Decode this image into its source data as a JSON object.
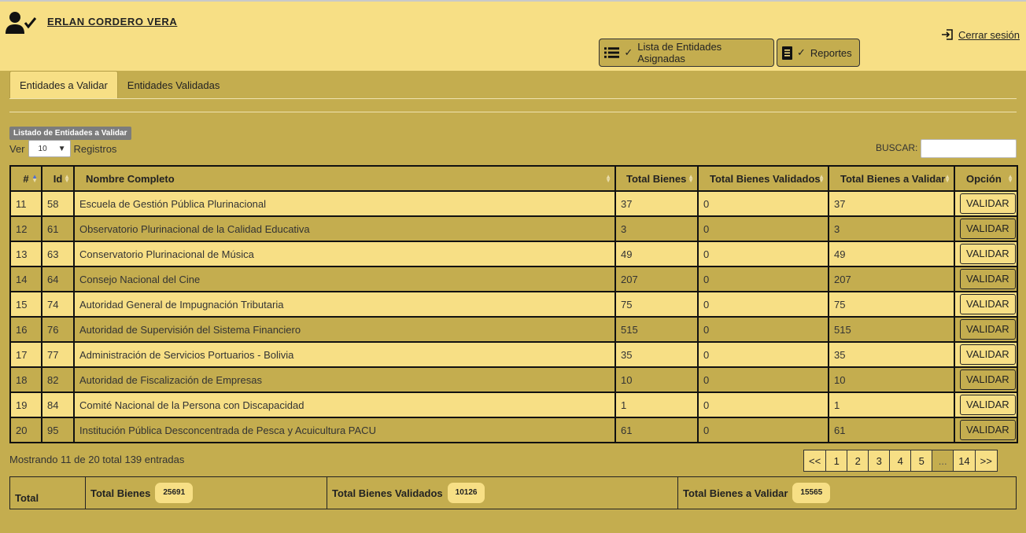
{
  "header": {
    "user_name": "ERLAN CORDERO VERA",
    "logout_label": "Cerrar sesión",
    "btn_list_label": "Lista de Entidades Asignadas",
    "btn_reports_label": "Reportes",
    "check_mark": "✓"
  },
  "tabs": [
    {
      "label": "Entidades a Validar",
      "active": true
    },
    {
      "label": "Entidades Validadas",
      "active": false
    }
  ],
  "listing": {
    "badge": "Listado de Entidades a Validar",
    "ver_label": "Ver",
    "page_size": "10",
    "registros_label": "Registros",
    "search_label": "BUSCAR:",
    "search_value": ""
  },
  "table": {
    "columns": [
      "#",
      "Id",
      "Nombre Completo",
      "Total Bienes",
      "Total Bienes Validados",
      "Total Bienes a Validar",
      "Opción"
    ],
    "button_label": "VALIDAR",
    "rows": [
      [
        "11",
        "58",
        "Escuela de Gestión Pública Plurinacional",
        "37",
        "0",
        "37"
      ],
      [
        "12",
        "61",
        "Observatorio Plurinacional de la Calidad Educativa",
        "3",
        "0",
        "3"
      ],
      [
        "13",
        "63",
        "Conservatorio Plurinacional de Música",
        "49",
        "0",
        "49"
      ],
      [
        "14",
        "64",
        "Consejo Nacional del Cine",
        "207",
        "0",
        "207"
      ],
      [
        "15",
        "74",
        "Autoridad General de Impugnación Tributaria",
        "75",
        "0",
        "75"
      ],
      [
        "16",
        "76",
        "Autoridad de Supervisión del Sistema Financiero",
        "515",
        "0",
        "515"
      ],
      [
        "17",
        "77",
        "Administración de Servicios Portuarios - Bolivia",
        "35",
        "0",
        "35"
      ],
      [
        "18",
        "82",
        "Autoridad de Fiscalización de Empresas",
        "10",
        "0",
        "10"
      ],
      [
        "19",
        "84",
        "Comité Nacional de la Persona con Discapacidad",
        "1",
        "0",
        "1"
      ],
      [
        "20",
        "95",
        "Institución Pública Desconcentrada de Pesca y Acuicultura PACU",
        "61",
        "0",
        "61"
      ]
    ]
  },
  "info": "Mostrando 11 de 20 total 139 entradas",
  "pagination": [
    "<<",
    "1",
    "2",
    "3",
    "4",
    "5",
    "...",
    "14",
    ">>"
  ],
  "totals": {
    "label": "Total",
    "bienes_label": "Total Bienes",
    "bienes_value": "25691",
    "validados_label": "Total Bienes Validados",
    "validados_value": "10126",
    "a_validar_label": "Total Bienes a Validar",
    "a_validar_value": "15565"
  },
  "colors": {
    "header_bg": "#f7df85",
    "body_bg": "#c4ad4f"
  },
  "icons": {
    "user": "user-check-icon",
    "logout": "logout-icon",
    "list": "list-icon",
    "report": "document-icon"
  }
}
